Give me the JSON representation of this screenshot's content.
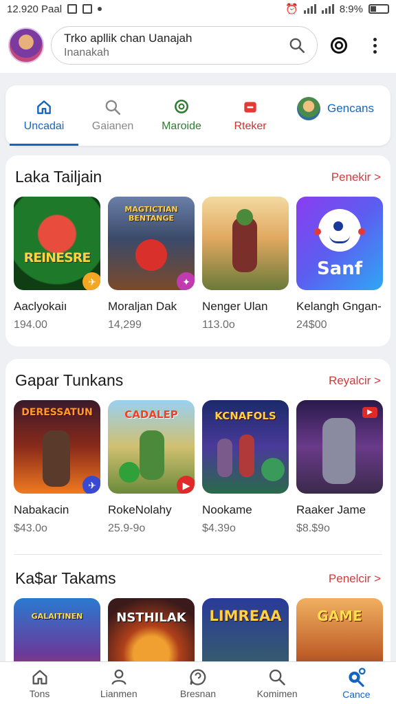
{
  "status": {
    "time": "12.920 Paal",
    "battery": "8:9%"
  },
  "search": {
    "title": "Trko apllik chan Uanajah",
    "subtitle": "Inanakah"
  },
  "tabs": [
    {
      "label": "Uncadai",
      "icon": "home-icon",
      "active": true
    },
    {
      "label": "Gaianen",
      "icon": "search-icon",
      "active": false
    },
    {
      "label": "Maroide",
      "icon": "chat-icon",
      "active": false
    },
    {
      "label": "Rteker",
      "icon": "tag-icon",
      "active": false
    }
  ],
  "profile_tab": {
    "label": "Gencans"
  },
  "sections": [
    {
      "title": "Laka Tailjain",
      "more": "Penekir >",
      "apps": [
        {
          "name": "Aaclyokaiı",
          "price": "194.00",
          "art": "REINESRE"
        },
        {
          "name": "Moraljan Dak",
          "price": "14,299",
          "art": "MAGTICTIAN BENTANGE"
        },
        {
          "name": "Nenger Ulan",
          "price": "113.0o",
          "art": ""
        },
        {
          "name": "Kelangh Gngan-",
          "price": "24$00",
          "art": "Sanf"
        }
      ]
    },
    {
      "title": "Gapar Tunkans",
      "more": "Reyalcir >",
      "apps": [
        {
          "name": "Nabakacin",
          "price": "$43.0o",
          "art": "DERESSATUN"
        },
        {
          "name": "RokeNolahy",
          "price": "25.9-9o",
          "art": "CADALEP"
        },
        {
          "name": "Nookame",
          "price": "$4.39o",
          "art": "KCNAFOLS"
        },
        {
          "name": "Raaker Jame",
          "price": "$8.$9o",
          "art": ""
        }
      ]
    },
    {
      "title": "Ka$ar Takams",
      "more": "Penelcir >",
      "apps": [
        {
          "art": "GALAITINEN"
        },
        {
          "art": "NSTHILAK"
        },
        {
          "art": "LIMREAA"
        },
        {
          "art": "GAME"
        }
      ]
    }
  ],
  "bottom_nav": [
    {
      "label": "Tons",
      "icon": "home-icon"
    },
    {
      "label": "Lianmen",
      "icon": "person-icon"
    },
    {
      "label": "Bresnan",
      "icon": "chat-bubble-icon"
    },
    {
      "label": "Komimen",
      "icon": "search-icon"
    },
    {
      "label": "Cance",
      "icon": "search-active-icon",
      "active": true
    }
  ],
  "colors": {
    "accent": "#1565c0",
    "link": "#d23b3b"
  }
}
